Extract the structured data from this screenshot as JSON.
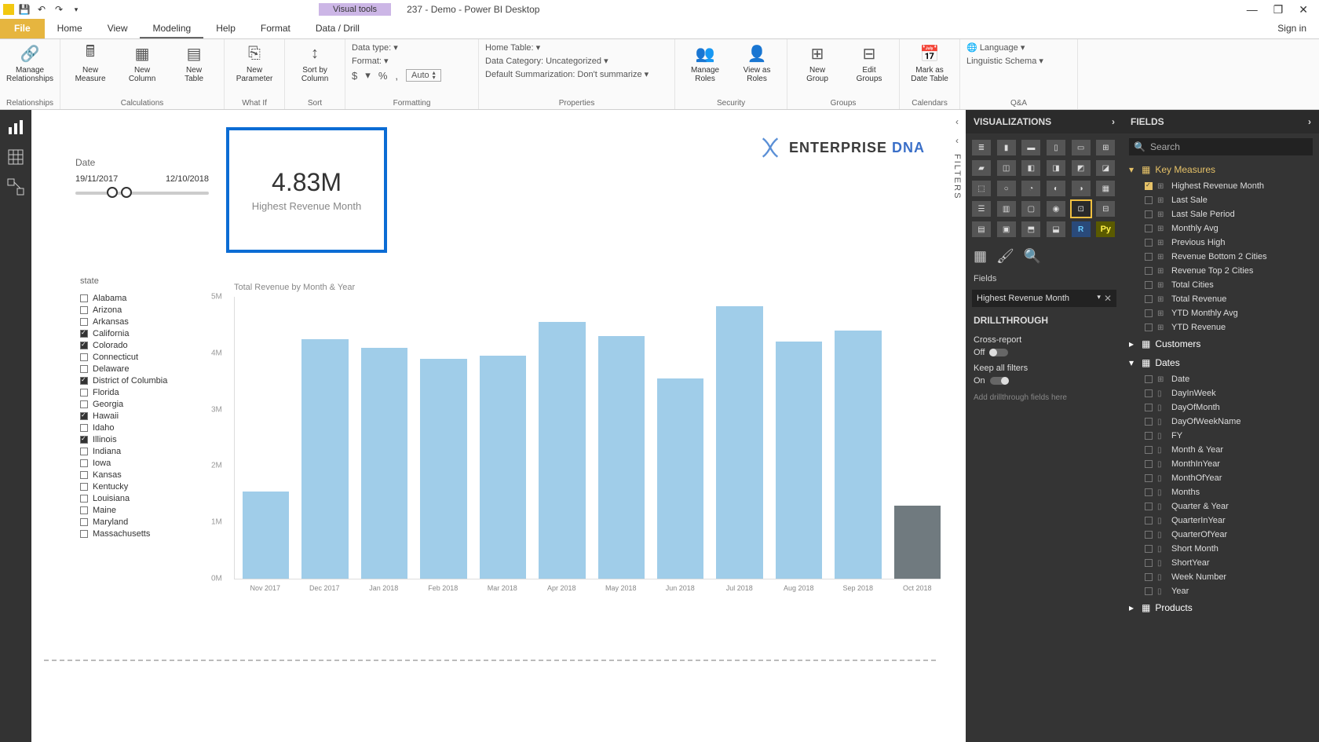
{
  "titlebar": {
    "visual_tools": "Visual tools",
    "doc": "237 - Demo - Power BI Desktop"
  },
  "tabs": {
    "file": "File",
    "home": "Home",
    "view": "View",
    "modeling": "Modeling",
    "help": "Help",
    "format": "Format",
    "datadrill": "Data / Drill",
    "signin": "Sign in"
  },
  "ribbon": {
    "manage_relationships": "Manage\nRelationships",
    "new_measure": "New\nMeasure",
    "new_column": "New\nColumn",
    "new_table": "New\nTable",
    "new_parameter": "New\nParameter",
    "sort_by_column": "Sort by\nColumn",
    "data_type": "Data type:",
    "format": "Format:",
    "dollar": "$",
    "percent": "%",
    "comma": ",",
    "auto": "Auto",
    "home_table": "Home Table:",
    "data_category": "Data Category: Uncategorized",
    "default_summarization": "Default Summarization: Don't summarize",
    "manage_roles": "Manage\nRoles",
    "view_as_roles": "View as\nRoles",
    "new_group": "New\nGroup",
    "edit_groups": "Edit\nGroups",
    "mark_as_date_table": "Mark as\nDate Table",
    "language": "Language",
    "linguistic_schema": "Linguistic Schema",
    "grp_relationships": "Relationships",
    "grp_calculations": "Calculations",
    "grp_whatif": "What If",
    "grp_sort": "Sort",
    "grp_formatting": "Formatting",
    "grp_properties": "Properties",
    "grp_security": "Security",
    "grp_groups": "Groups",
    "grp_calendars": "Calendars",
    "grp_qa": "Q&A"
  },
  "date_slicer": {
    "label": "Date",
    "start": "19/11/2017",
    "end": "12/10/2018"
  },
  "card": {
    "value": "4.83M",
    "label": "Highest Revenue Month"
  },
  "logo": {
    "brand1": "ENTERPRISE",
    "brand2": "DNA"
  },
  "state_slicer": {
    "label": "state",
    "items": [
      {
        "name": "Alabama",
        "checked": false
      },
      {
        "name": "Arizona",
        "checked": false
      },
      {
        "name": "Arkansas",
        "checked": false
      },
      {
        "name": "California",
        "checked": true
      },
      {
        "name": "Colorado",
        "checked": true
      },
      {
        "name": "Connecticut",
        "checked": false
      },
      {
        "name": "Delaware",
        "checked": false
      },
      {
        "name": "District of Columbia",
        "checked": true
      },
      {
        "name": "Florida",
        "checked": false
      },
      {
        "name": "Georgia",
        "checked": false
      },
      {
        "name": "Hawaii",
        "checked": true
      },
      {
        "name": "Idaho",
        "checked": false
      },
      {
        "name": "Illinois",
        "checked": true
      },
      {
        "name": "Indiana",
        "checked": false
      },
      {
        "name": "Iowa",
        "checked": false
      },
      {
        "name": "Kansas",
        "checked": false
      },
      {
        "name": "Kentucky",
        "checked": false
      },
      {
        "name": "Louisiana",
        "checked": false
      },
      {
        "name": "Maine",
        "checked": false
      },
      {
        "name": "Maryland",
        "checked": false
      },
      {
        "name": "Massachusetts",
        "checked": false
      }
    ]
  },
  "chart_data": {
    "type": "bar",
    "title": "Total Revenue by Month & Year",
    "ylabel": "",
    "ylim": [
      0,
      5
    ],
    "yticks": [
      "0M",
      "1M",
      "2M",
      "3M",
      "4M",
      "5M"
    ],
    "categories": [
      "Nov 2017",
      "Dec 2017",
      "Jan 2018",
      "Feb 2018",
      "Mar 2018",
      "Apr 2018",
      "May 2018",
      "Jun 2018",
      "Jul 2018",
      "Aug 2018",
      "Sep 2018",
      "Oct 2018"
    ],
    "values": [
      1.55,
      4.25,
      4.1,
      3.9,
      3.95,
      4.55,
      4.3,
      3.55,
      4.83,
      4.2,
      4.4,
      1.3
    ],
    "highlight_index": 11
  },
  "collapse": {
    "filters": "FILTERS"
  },
  "vizpane": {
    "header": "VISUALIZATIONS",
    "fields_label": "Fields",
    "well_value": "Highest Revenue Month",
    "drill_header": "DRILLTHROUGH",
    "cross_report": "Cross-report",
    "cross_report_state": "Off",
    "keep_filters": "Keep all filters",
    "keep_filters_state": "On",
    "placeholder": "Add drillthrough fields here"
  },
  "fieldspane": {
    "header": "FIELDS",
    "search_placeholder": "Search",
    "tables": [
      {
        "name": "Key Measures",
        "expanded": true,
        "style": "key",
        "fields": [
          {
            "name": "Highest Revenue Month",
            "checked": true,
            "calc": true
          },
          {
            "name": "Last Sale",
            "checked": false,
            "calc": true
          },
          {
            "name": "Last Sale Period",
            "checked": false,
            "calc": true
          },
          {
            "name": "Monthly Avg",
            "checked": false,
            "calc": true
          },
          {
            "name": "Previous High",
            "checked": false,
            "calc": true
          },
          {
            "name": "Revenue Bottom 2 Cities",
            "checked": false,
            "calc": true
          },
          {
            "name": "Revenue Top 2 Cities",
            "checked": false,
            "calc": true
          },
          {
            "name": "Total Cities",
            "checked": false,
            "calc": true
          },
          {
            "name": "Total Revenue",
            "checked": false,
            "calc": true
          },
          {
            "name": "YTD Monthly Avg",
            "checked": false,
            "calc": true
          },
          {
            "name": "YTD Revenue",
            "checked": false,
            "calc": true
          }
        ]
      },
      {
        "name": "Customers",
        "expanded": false,
        "style": ""
      },
      {
        "name": "Dates",
        "expanded": true,
        "style": "",
        "fields": [
          {
            "name": "Date",
            "checked": false,
            "calc": true
          },
          {
            "name": "DayInWeek",
            "checked": false
          },
          {
            "name": "DayOfMonth",
            "checked": false
          },
          {
            "name": "DayOfWeekName",
            "checked": false
          },
          {
            "name": "FY",
            "checked": false
          },
          {
            "name": "Month & Year",
            "checked": false
          },
          {
            "name": "MonthInYear",
            "checked": false
          },
          {
            "name": "MonthOfYear",
            "checked": false
          },
          {
            "name": "Months",
            "checked": false
          },
          {
            "name": "Quarter & Year",
            "checked": false
          },
          {
            "name": "QuarterInYear",
            "checked": false
          },
          {
            "name": "QuarterOfYear",
            "checked": false
          },
          {
            "name": "Short Month",
            "checked": false
          },
          {
            "name": "ShortYear",
            "checked": false
          },
          {
            "name": "Week Number",
            "checked": false
          },
          {
            "name": "Year",
            "checked": false
          }
        ]
      },
      {
        "name": "Products",
        "expanded": false,
        "style": ""
      }
    ]
  }
}
